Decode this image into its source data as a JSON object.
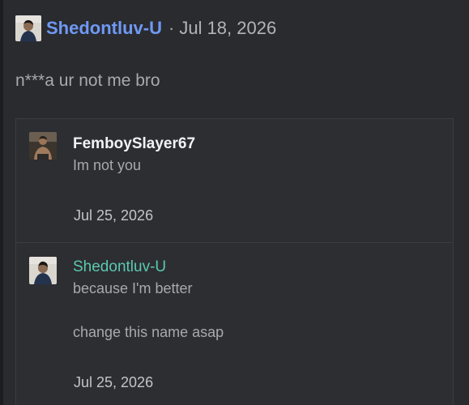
{
  "post": {
    "author": "Shedontluv-U",
    "separator": "·",
    "date": "Jul 18, 2026",
    "body": "n***a ur not me bro",
    "author_color": "#6f99f4"
  },
  "replies": [
    {
      "author": "FemboySlayer67",
      "author_color": "#f2f2f4",
      "lines": [
        "Im not you"
      ],
      "date": "Jul 25, 2026"
    },
    {
      "author": "Shedontluv-U",
      "author_color": "#5bc9b0",
      "lines": [
        "because I'm better",
        "change this name asap"
      ],
      "date": "Jul 25, 2026"
    }
  ]
}
